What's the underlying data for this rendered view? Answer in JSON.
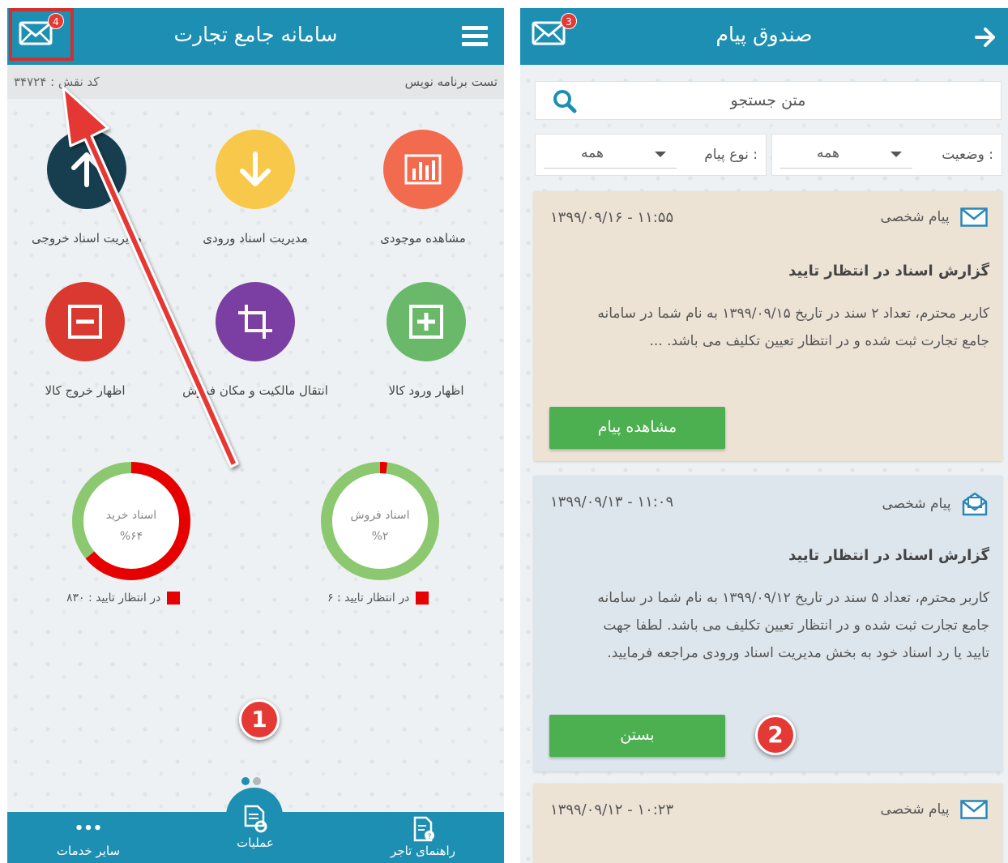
{
  "left_screen": {
    "header": {
      "title": "سامانه جامع تجارت",
      "mail_badge": "4"
    },
    "subheader": {
      "user_name": "تست برنامه نویس",
      "role_code": "کد نقش : ۳۴۷۲۴"
    },
    "tiles": [
      {
        "label": "مشاهده موجودی",
        "icon": "chart-icon",
        "color": "#f26b4f"
      },
      {
        "label": "مدیریت اسناد ورودی",
        "icon": "arrow-down-icon",
        "color": "#f8c84a"
      },
      {
        "label": "مدیریت اسناد خروجی",
        "icon": "arrow-up-icon",
        "color": "#163e4f"
      },
      {
        "label": "اظهار ورود کالا",
        "icon": "plus-box-icon",
        "color": "#6ab86a"
      },
      {
        "label": "انتقال مالکیت و مکان فروش",
        "icon": "crop-icon",
        "color": "#7b3fa3"
      },
      {
        "label": "اظهار خروج کالا",
        "icon": "minus-box-icon",
        "color": "#d9392f"
      }
    ],
    "donuts": [
      {
        "title": "اسناد فروش",
        "percent_label": "%۲",
        "percent": 2,
        "legend": "در انتظار تایید : ۶"
      },
      {
        "title": "اسناد خرید",
        "percent_label": "%۶۴",
        "percent": 64,
        "legend": "در انتظار تایید : ۸۳۰"
      }
    ],
    "step_number": "1",
    "bottom_nav": {
      "guide": "راهنمای تاجر",
      "operations": "عملیات",
      "more": "سایر خدمات",
      "more_icon": "•••"
    }
  },
  "right_screen": {
    "header": {
      "title": "صندوق پیام",
      "mail_badge": "3"
    },
    "search": {
      "placeholder": "متن جستجو"
    },
    "filters": {
      "status_label": "وضعیت :",
      "status_value": "همه",
      "type_label": "نوع پیام :",
      "type_value": "همه"
    },
    "messages": [
      {
        "datetime": "۱۳۹۹/۰۹/۱۶ - ۱۱:۵۵",
        "type": "پیام شخصی",
        "subject": "گزارش اسناد در انتظار تایید",
        "body": "کاربر محترم، تعداد ۲ سند در تاریخ  ۱۳۹۹/۰۹/۱۵  به نام شما در سامانه جامع تجارت ثبت شده و در انتظار تعیین تکلیف می باشد. ...",
        "button": "مشاهده پیام",
        "bg": "#ece3d5"
      },
      {
        "datetime": "۱۳۹۹/۰۹/۱۳ - ۱۱:۰۹",
        "type": "پیام شخصی",
        "subject": "گزارش اسناد در انتظار تایید",
        "body": "کاربر محترم، تعداد ۵ سند در تاریخ  ۱۳۹۹/۰۹/۱۲  به نام شما در سامانه جامع تجارت ثبت شده و در انتظار تعیین تکلیف می باشد. لطفا جهت تایید یا رد اسناد خود به بخش مدیریت اسناد ورودی مراجعه فرمایید.",
        "button": "بستن",
        "bg": "#dde6ec"
      },
      {
        "datetime": "۱۳۹۹/۰۹/۱۲ - ۱۰:۲۳",
        "type": "پیام شخصی",
        "bg": "#ece3d5"
      }
    ],
    "step_number": "2"
  },
  "colors": {
    "accent": "#1d8fb2",
    "green": "#4caf50",
    "donut_green": "#8cc870",
    "donut_red": "#e60000"
  }
}
